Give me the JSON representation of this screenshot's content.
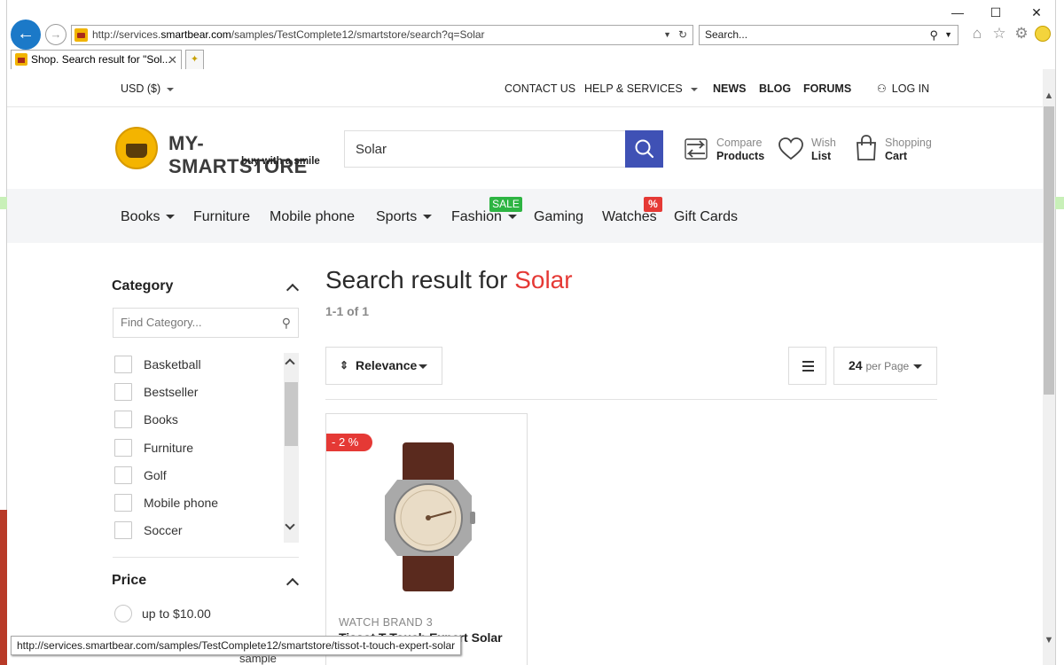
{
  "browser": {
    "address_url_prefix": "http://services.",
    "address_url_domain": "smartbear.com",
    "address_url_path": "/samples/TestComplete12/smartstore/search?q=Solar",
    "search_placeholder": "Search...",
    "tab_title": "Shop. Search result for \"Sol...",
    "status_url": "http://services.smartbear.com/samples/TestComplete12/smartstore/tissot-t-touch-expert-solar",
    "peek_text": "sample"
  },
  "utility": {
    "currency": "USD ($)",
    "contact": "CONTACT US",
    "help": "HELP & SERVICES",
    "news": "NEWS",
    "blog": "BLOG",
    "forums": "FORUMS",
    "login": "LOG IN"
  },
  "header": {
    "logo_name": "MY-SMARTSTORE",
    "logo_tagline": "buy with a smile",
    "search_value": "Solar",
    "compare_l1": "Compare",
    "compare_l2": "Products",
    "wish_l1": "Wish",
    "wish_l2": "List",
    "cart_l1": "Shopping",
    "cart_l2": "Cart"
  },
  "nav": {
    "items": [
      "Books",
      "Furniture",
      "Mobile phone",
      "Sports",
      "Fashion",
      "Gaming",
      "Watches",
      "Gift Cards"
    ],
    "sale_badge": "SALE",
    "pct_badge": "%"
  },
  "sidebar": {
    "category_title": "Category",
    "find_placeholder": "Find Category...",
    "categories": [
      "Basketball",
      "Bestseller",
      "Books",
      "Furniture",
      "Golf",
      "Mobile phone",
      "Soccer"
    ],
    "price_title": "Price",
    "price_options": [
      "up to $10.00"
    ]
  },
  "results": {
    "title_prefix": "Search result for",
    "term": "Solar",
    "count": "1-1 of 1",
    "sort_label": "Relevance",
    "per_page_value": "24",
    "per_page_label": "per Page"
  },
  "product": {
    "discount": "- 2 %",
    "brand": "WATCH BRAND 3",
    "name": "Tissot T-Touch Expert Solar"
  },
  "colors": {
    "accent": "#3f51b5",
    "sale": "#2db442",
    "red": "#e53935"
  }
}
